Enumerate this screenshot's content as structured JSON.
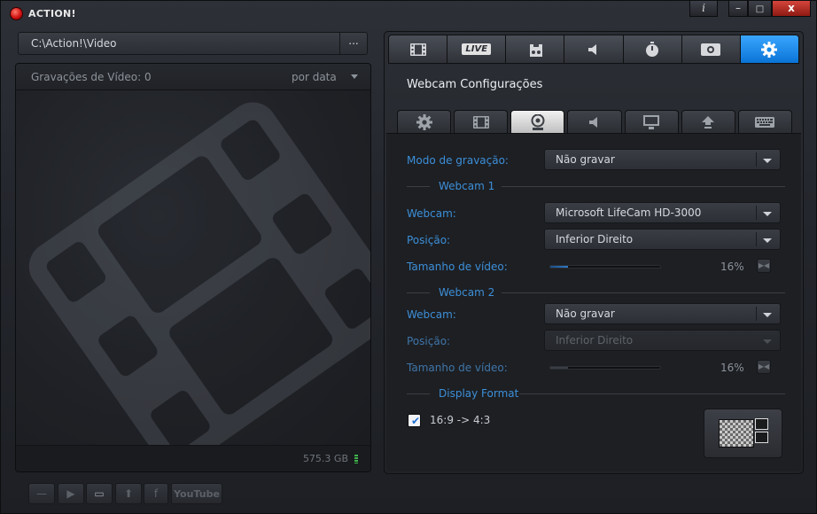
{
  "app": {
    "title": "ACTION!"
  },
  "titlebar": {
    "info_label": "i",
    "minimize_label": "–",
    "restore_label": "□",
    "close_label": "x"
  },
  "path": {
    "value": "C:\\Action!\\Video",
    "browse_label": "..."
  },
  "recordings": {
    "count_label": "Gravações de Vídeo: 0",
    "sort_label": "por data",
    "disk_free": "575.3 GB"
  },
  "bottom_buttons": [
    {
      "name": "delete-button",
      "icon": "minus-icon",
      "glyph": "—"
    },
    {
      "name": "play-button",
      "icon": "play-icon",
      "glyph": "▶"
    },
    {
      "name": "open-folder-button",
      "icon": "folder-icon",
      "glyph": "▭"
    },
    {
      "name": "upload-button",
      "icon": "upload-icon",
      "glyph": "⬆"
    },
    {
      "name": "facebook-button",
      "icon": "facebook-icon",
      "glyph": "f"
    },
    {
      "name": "youtube-button",
      "icon": "youtube-icon",
      "glyph": "YouTube"
    }
  ],
  "top_tabs": [
    {
      "icon": "film-icon",
      "active": false
    },
    {
      "icon": "live-icon",
      "label": "LIVE",
      "active": false
    },
    {
      "icon": "game-controller-icon",
      "active": false
    },
    {
      "icon": "speaker-icon",
      "active": false
    },
    {
      "icon": "stopwatch-icon",
      "active": false
    },
    {
      "icon": "camera-icon",
      "active": false
    },
    {
      "icon": "gear-icon",
      "active": true
    }
  ],
  "section_title": "Webcam Configurações",
  "sub_tabs": [
    {
      "icon": "gear-icon",
      "active": false
    },
    {
      "icon": "film-icon",
      "active": false
    },
    {
      "icon": "webcam-icon",
      "active": true
    },
    {
      "icon": "speaker-icon",
      "active": false
    },
    {
      "icon": "monitor-icon",
      "active": false
    },
    {
      "icon": "upload-icon",
      "active": false
    },
    {
      "icon": "keyboard-icon",
      "active": false
    }
  ],
  "webcam": {
    "mode_label": "Modo de gravação:",
    "mode_value": "Não gravar",
    "group1": {
      "title": "Webcam 1",
      "webcam_label": "Webcam:",
      "webcam_value": "Microsoft LifeCam HD-3000",
      "position_label": "Posição:",
      "position_value": "Inferior Direito",
      "size_label": "Tamanho de vídeo:",
      "size_percent": "16%",
      "size_value": 0.16
    },
    "group2": {
      "title": "Webcam 2",
      "webcam_label": "Webcam:",
      "webcam_value": "Não gravar",
      "position_label": "Posição:",
      "position_value": "Inferior Direito",
      "size_label": "Tamanho de vídeo:",
      "size_percent": "16%",
      "size_value": 0.16
    },
    "display_format": {
      "title": "Display Format",
      "checkbox_label": "16:9 -> 4:3",
      "checked": true
    }
  },
  "colors": {
    "accent": "#0a74d6",
    "label_blue": "#3d8fd8",
    "close_red": "#c2342b"
  }
}
